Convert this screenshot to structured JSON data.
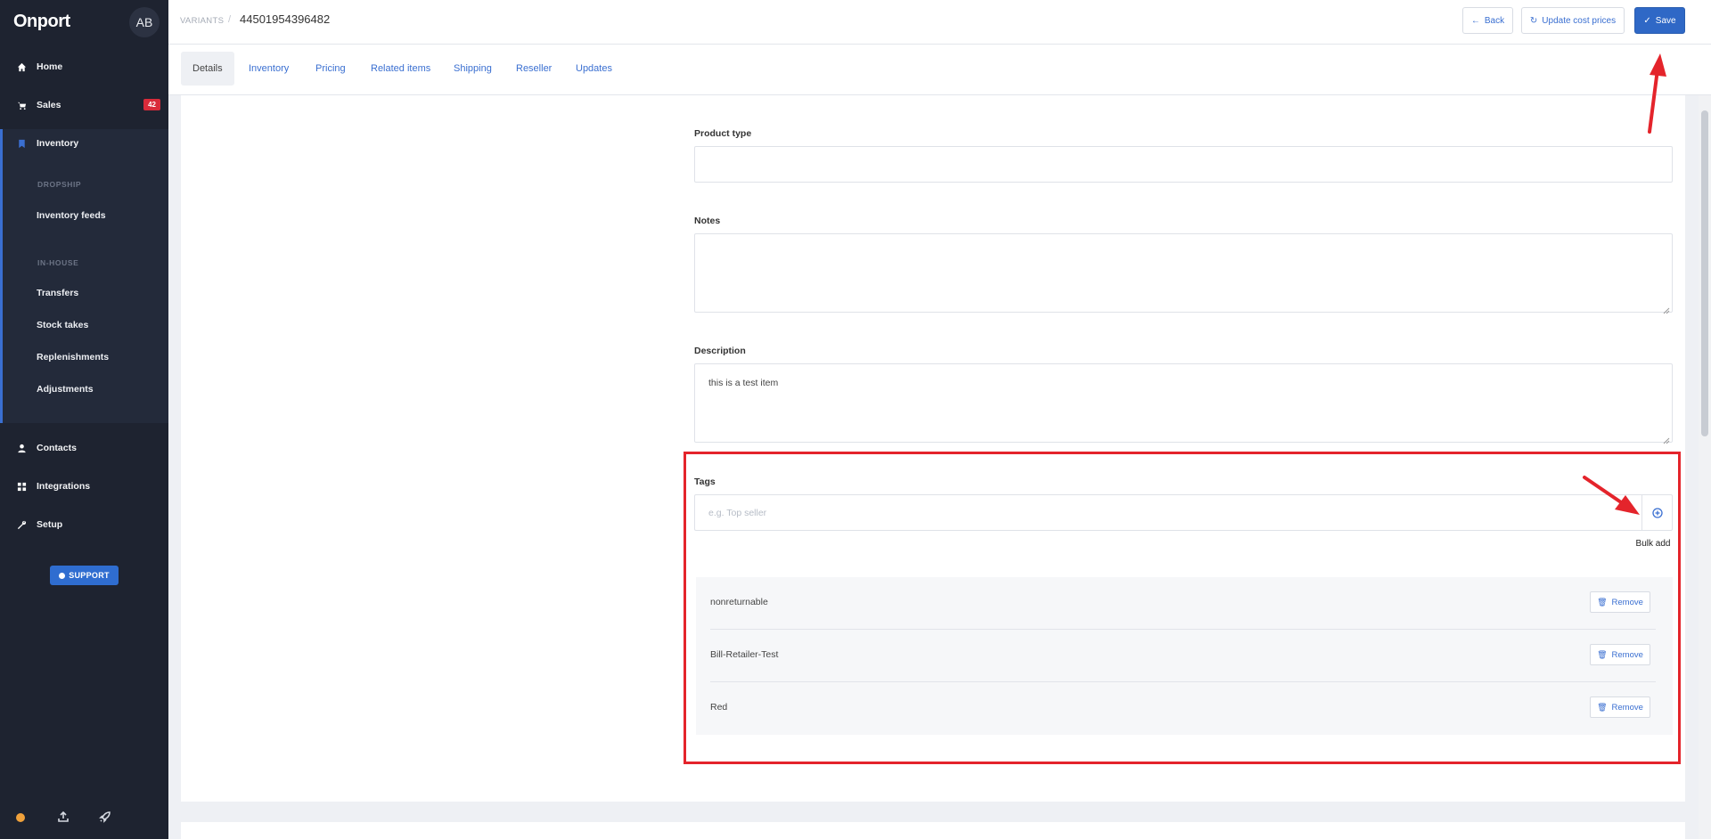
{
  "app": {
    "name": "Onport",
    "user_initials": "AB"
  },
  "sidebar": {
    "items": [
      {
        "label": "Home",
        "icon": "home-icon"
      },
      {
        "label": "Sales",
        "icon": "cart-icon",
        "badge": "42"
      },
      {
        "label": "Inventory",
        "icon": "bookmark-icon"
      },
      {
        "label": "Contacts",
        "icon": "person-icon"
      },
      {
        "label": "Integrations",
        "icon": "grid-icon"
      },
      {
        "label": "Setup",
        "icon": "wrench-icon"
      }
    ],
    "inventory_sections": [
      {
        "heading": "DROPSHIP",
        "items": [
          "Inventory feeds"
        ]
      },
      {
        "heading": "IN-HOUSE",
        "items": [
          "Transfers",
          "Stock takes",
          "Replenishments",
          "Adjustments"
        ]
      }
    ],
    "support_label": "SUPPORT",
    "status_color": "#f0a13b"
  },
  "header": {
    "breadcrumb_label": "VARIANTS",
    "breadcrumb_sep": "/",
    "record_id": "44501954396482",
    "back_label": "Back",
    "update_prices_label": "Update cost prices",
    "save_label": "Save"
  },
  "tabs": [
    {
      "label": "Details",
      "active": true
    },
    {
      "label": "Inventory"
    },
    {
      "label": "Pricing"
    },
    {
      "label": "Related items"
    },
    {
      "label": "Shipping"
    },
    {
      "label": "Reseller"
    },
    {
      "label": "Updates"
    }
  ],
  "form": {
    "product_type": {
      "label": "Product type",
      "value": ""
    },
    "notes": {
      "label": "Notes",
      "value": ""
    },
    "description": {
      "label": "Description",
      "value": "this is a test item"
    },
    "tags": {
      "label": "Tags",
      "placeholder": "e.g. Top seller",
      "bulk_add_tooltip": "Bulk add",
      "items": [
        {
          "name": "nonreturnable",
          "remove_label": "Remove"
        },
        {
          "name": "Bill-Retailer-Test",
          "remove_label": "Remove"
        },
        {
          "name": "Red",
          "remove_label": "Remove"
        }
      ]
    }
  },
  "colors": {
    "sidebar_bg": "#1e2330",
    "accent": "#2f68c6",
    "annotation": "#e4242b",
    "badge": "#d92b3a"
  }
}
